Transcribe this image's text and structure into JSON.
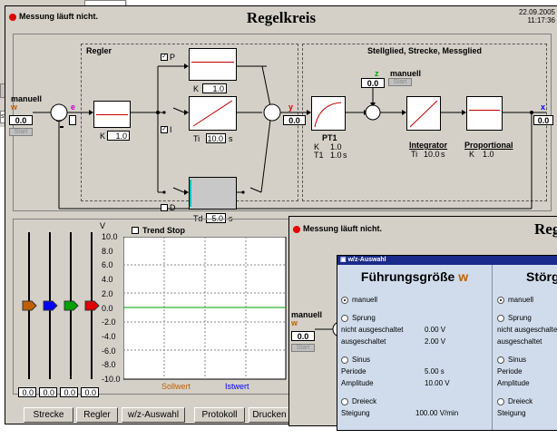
{
  "bg_window": {
    "left_tab": "K",
    "left_text": "sw"
  },
  "main": {
    "status": "Messung läuft nicht.",
    "title": "Regelkreis",
    "date": "22.09.2005",
    "time": "11:17:36",
    "regler": {
      "title": "Regler",
      "input_label": "manuell",
      "w_symbol": "w",
      "w_value": "0.0",
      "start_label": "Start",
      "e_symbol": "e",
      "block_k_label": "K",
      "block_k_value": "1.0",
      "p_check": "P",
      "p_k_label": "K",
      "p_k_value": "1.0",
      "i_check": "I",
      "i_ti_label": "Ti",
      "i_ti_value": "10.0",
      "i_ti_unit": "s",
      "d_check": "D",
      "d_td_label": "Td",
      "d_td_value": "5.0",
      "d_td_unit": "s",
      "y_symbol": "y",
      "y_value": "0.0"
    },
    "strecke": {
      "title": "Stellglied, Strecke, Messglied",
      "z_symbol": "z",
      "z_input_label": "manuell",
      "z_value": "0.0",
      "z_start_label": "Start",
      "pt1_name": "PT1",
      "pt1_k_label": "K",
      "pt1_k_value": "1.0",
      "pt1_t1_label": "T1",
      "pt1_t1_value": "1.0",
      "pt1_t1_unit": "s",
      "int_name": "Integrator",
      "int_ti_label": "Ti",
      "int_ti_value": "10.0",
      "int_ti_unit": "s",
      "prop_name": "Proportional",
      "prop_k_label": "K",
      "prop_k_value": "1.0",
      "x_symbol": "x",
      "x_value": "0.0"
    },
    "trend": {
      "v_label": "V",
      "trend_stop": "Trend Stop",
      "y_ticks": [
        "10.0",
        "8.0",
        "6.0",
        "4.0",
        "2.0",
        "0.0",
        "-2.0",
        "-4.0",
        "-6.0",
        "-8.0",
        "-10.0"
      ],
      "legend_sollwert": "Sollwert",
      "legend_istwert": "Istwert",
      "slider_values": [
        "0.0",
        "0.0",
        "0.0",
        "0.0"
      ],
      "slider_colors": [
        "#c06000",
        "#0000ff",
        "#00a000",
        "#e00000"
      ]
    },
    "toolbar": {
      "strecke": "Strecke",
      "regler": "Regler",
      "wz": "w/z-Auswahl",
      "protokoll": "Protokoll",
      "drucken": "Drucken"
    }
  },
  "second": {
    "status": "Messung läuft nicht.",
    "title_partial": "Reg",
    "input_label": "manuell",
    "w_symbol": "w",
    "w_value": "0.0",
    "start_label": "Start",
    "dialog": {
      "title": "w/z-Auswahl",
      "col1_heading": "Führungsgröße",
      "col1_symbol": "w",
      "col2_heading": "Störg",
      "manuell": "manuell",
      "sprung": "Sprung",
      "nicht_ausgeschaltet": "nicht ausgeschaltet",
      "nicht_ausgeschaltet_value": "0.00 V",
      "ausgeschaltet": "ausgeschaltet",
      "ausgeschaltet_value": "2.00 V",
      "sinus": "Sinus",
      "periode": "Periode",
      "periode_value": "5.00 s",
      "amplitude": "Amplitude",
      "amplitude_value": "10.00 V",
      "dreieck": "Dreieck",
      "steigung": "Steigung",
      "steigung_value": "100.00 V/min",
      "col2_nicht": "nicht ausgeschalte",
      "col2_aus": "ausgeschaltet",
      "col2_periode": "Periode",
      "col2_amplitude": "Amplitude",
      "col2_steigung": "Steigung"
    }
  }
}
